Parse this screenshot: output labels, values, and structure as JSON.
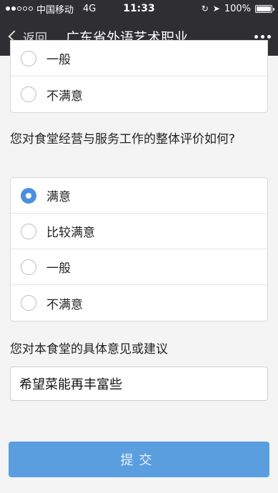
{
  "status_bar": {
    "carrier": "中国移动",
    "network": "4G",
    "time": "11:33",
    "battery": "100%"
  },
  "nav": {
    "back_label": "返回",
    "title": "广东省外语艺术职业..."
  },
  "question_prev": {
    "options": [
      "一般",
      "不满意"
    ]
  },
  "question_canteen": {
    "text": "您对食堂经营与服务工作的整体评价如何?",
    "options": [
      "满意",
      "比较满意",
      "一般",
      "不满意"
    ],
    "selected": "满意"
  },
  "question_suggestion": {
    "text": "您对本食堂的具体意见或建议",
    "value": "希望菜能再丰富些"
  },
  "submit_label": "提交"
}
